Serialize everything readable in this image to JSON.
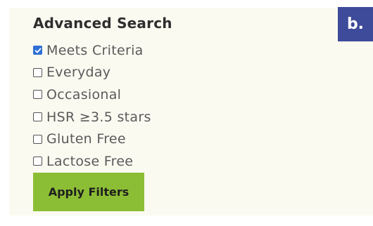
{
  "panel": {
    "title": "Advanced Search",
    "badge": "b.",
    "options": [
      {
        "label": "Meets Criteria",
        "checked": true
      },
      {
        "label": "Everyday",
        "checked": false
      },
      {
        "label": "Occasional",
        "checked": false
      },
      {
        "label": "HSR ≥3.5 stars",
        "checked": false
      },
      {
        "label": "Gluten Free",
        "checked": false
      },
      {
        "label": "Lactose Free",
        "checked": false
      }
    ],
    "apply_label": "Apply Filters"
  },
  "colors": {
    "panel_bg": "#fbfaf1",
    "badge_bg": "#3e4a9a",
    "checkbox_checked": "#2f6fd6",
    "apply_button": "#8cbe35"
  },
  "icons": {
    "checked": "check-icon"
  }
}
